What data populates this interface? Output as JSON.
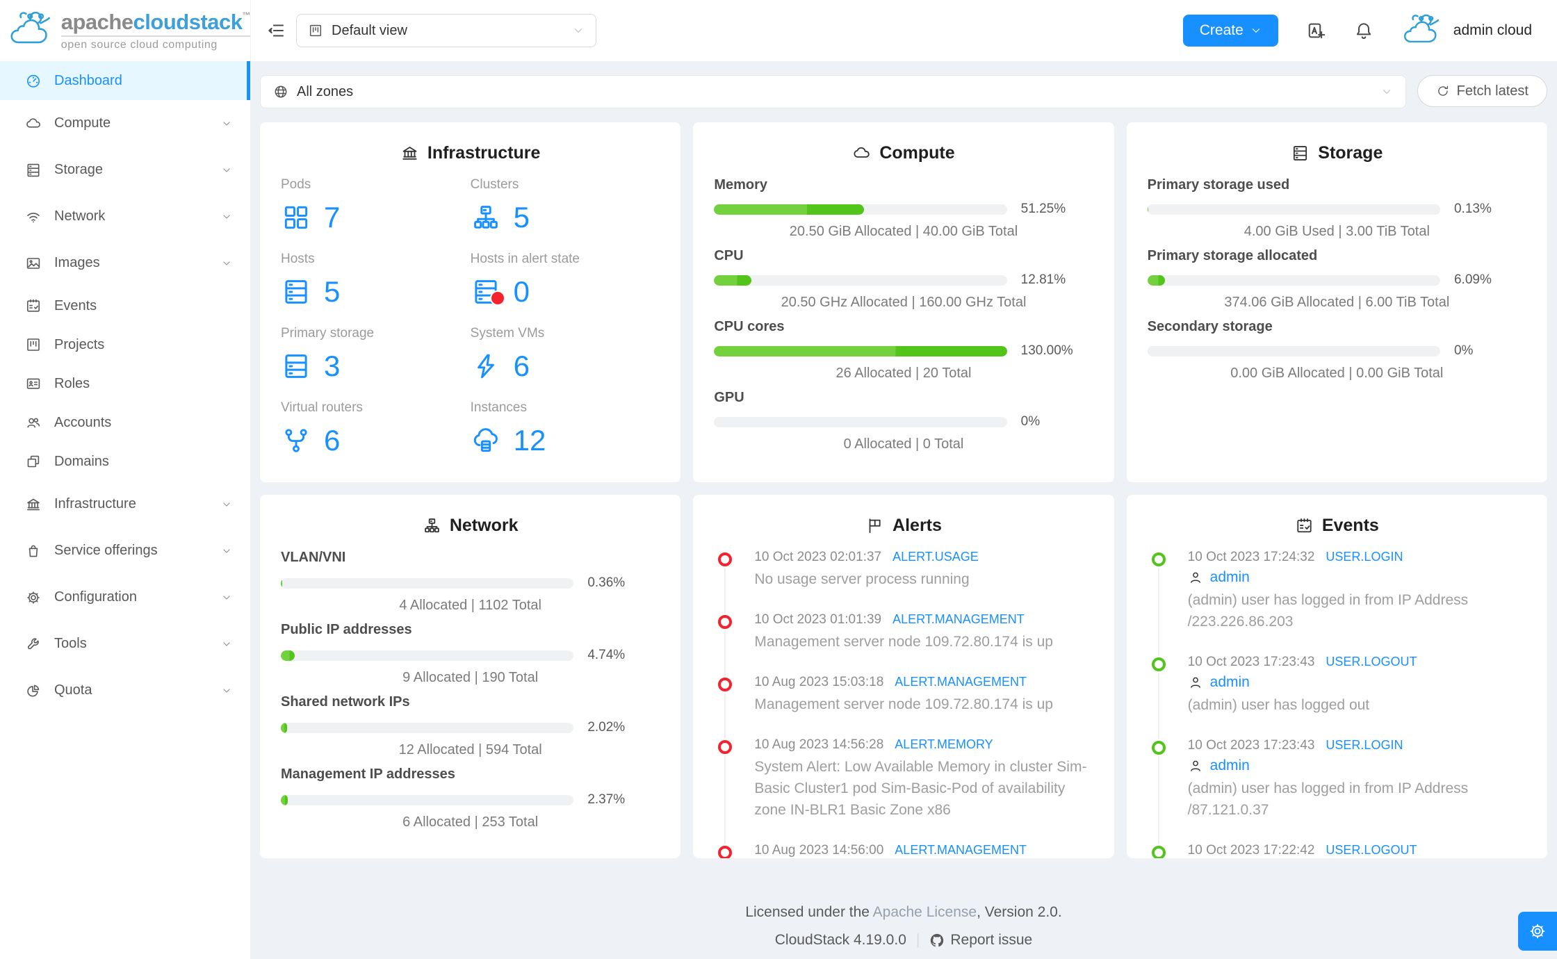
{
  "brand": {
    "title_gray": "apache",
    "title_blue": "cloudstack",
    "tm": "™",
    "subtitle": "open source cloud computing"
  },
  "header": {
    "view_select": "Default view",
    "create_label": "Create",
    "username": "admin cloud"
  },
  "zonebar": {
    "zone_select": "All zones",
    "fetch_label": "Fetch latest"
  },
  "sidebar": {
    "items": [
      {
        "label": "Dashboard"
      },
      {
        "label": "Compute"
      },
      {
        "label": "Storage"
      },
      {
        "label": "Network"
      },
      {
        "label": "Images"
      },
      {
        "label": "Events"
      },
      {
        "label": "Projects"
      },
      {
        "label": "Roles"
      },
      {
        "label": "Accounts"
      },
      {
        "label": "Domains"
      },
      {
        "label": "Infrastructure"
      },
      {
        "label": "Service offerings"
      },
      {
        "label": "Configuration"
      },
      {
        "label": "Tools"
      },
      {
        "label": "Quota"
      }
    ]
  },
  "infrastructure": {
    "title": "Infrastructure",
    "stats": [
      {
        "label": "Pods",
        "value": "7"
      },
      {
        "label": "Clusters",
        "value": "5"
      },
      {
        "label": "Hosts",
        "value": "5"
      },
      {
        "label": "Hosts in alert state",
        "value": "0"
      },
      {
        "label": "Primary storage",
        "value": "3"
      },
      {
        "label": "System VMs",
        "value": "6"
      },
      {
        "label": "Virtual routers",
        "value": "6"
      },
      {
        "label": "Instances",
        "value": "12"
      }
    ]
  },
  "compute": {
    "title": "Compute",
    "sections": [
      {
        "label": "Memory",
        "percent": "51.25%",
        "fill": 51.25,
        "info": "20.50 GiB Allocated | 40.00 GiB Total"
      },
      {
        "label": "CPU",
        "percent": "12.81%",
        "fill": 12.81,
        "info": "20.50 GHz Allocated | 160.00 GHz Total"
      },
      {
        "label": "CPU cores",
        "percent": "130.00%",
        "fill": 100,
        "info": "26 Allocated | 20 Total"
      },
      {
        "label": "GPU",
        "percent": "0%",
        "fill": 0,
        "info": "0 Allocated | 0 Total"
      }
    ]
  },
  "storage": {
    "title": "Storage",
    "sections": [
      {
        "label": "Primary storage used",
        "percent": "0.13%",
        "fill": 0.4,
        "info": "4.00 GiB Used | 3.00 TiB Total"
      },
      {
        "label": "Primary storage allocated",
        "percent": "6.09%",
        "fill": 6.09,
        "info": "374.06 GiB Allocated | 6.00 TiB Total"
      },
      {
        "label": "Secondary storage",
        "percent": "0%",
        "fill": 0,
        "info": "0.00 GiB Allocated | 0.00 GiB Total"
      }
    ]
  },
  "network": {
    "title": "Network",
    "sections": [
      {
        "label": "VLAN/VNI",
        "percent": "0.36%",
        "fill": 0.5,
        "info": "4 Allocated | 1102 Total"
      },
      {
        "label": "Public IP addresses",
        "percent": "4.74%",
        "fill": 4.74,
        "info": "9 Allocated | 190 Total"
      },
      {
        "label": "Shared network IPs",
        "percent": "2.02%",
        "fill": 2.02,
        "info": "12 Allocated | 594 Total"
      },
      {
        "label": "Management IP addresses",
        "percent": "2.37%",
        "fill": 2.37,
        "info": "6 Allocated | 253 Total"
      }
    ]
  },
  "alerts": {
    "title": "Alerts",
    "items": [
      {
        "time": "10 Oct 2023 02:01:37",
        "type": "ALERT.USAGE",
        "desc": "No usage server process running"
      },
      {
        "time": "10 Oct 2023 01:01:39",
        "type": "ALERT.MANAGEMENT",
        "desc": "Management server node 109.72.80.174 is up"
      },
      {
        "time": "10 Aug 2023 15:03:18",
        "type": "ALERT.MANAGEMENT",
        "desc": "Management server node 109.72.80.174 is up"
      },
      {
        "time": "10 Aug 2023 14:56:28",
        "type": "ALERT.MEMORY",
        "desc": "System Alert: Low Available Memory in cluster Sim-Basic Cluster1 pod Sim-Basic-Pod of availability zone IN-BLR1 Basic Zone x86"
      },
      {
        "time": "10 Aug 2023 14:56:00",
        "type": "ALERT.MANAGEMENT",
        "desc": ""
      }
    ]
  },
  "events": {
    "title": "Events",
    "items": [
      {
        "time": "10 Oct 2023 17:24:32",
        "type": "USER.LOGIN",
        "user": "admin",
        "desc": "(admin) user has logged in from IP Address /223.226.86.203"
      },
      {
        "time": "10 Oct 2023 17:23:43",
        "type": "USER.LOGOUT",
        "user": "admin",
        "desc": "(admin) user has logged out"
      },
      {
        "time": "10 Oct 2023 17:23:43",
        "type": "USER.LOGIN",
        "user": "admin",
        "desc": "(admin) user has logged in from IP Address /87.121.0.37"
      },
      {
        "time": "10 Oct 2023 17:22:42",
        "type": "USER.LOGOUT",
        "user": "",
        "desc": ""
      }
    ]
  },
  "footer": {
    "license_prefix": "Licensed under the ",
    "license_link": "Apache License",
    "license_suffix": ", Version 2.0.",
    "version": "CloudStack 4.19.0.0",
    "divider": "|",
    "report_label": "Report issue"
  },
  "colors": {
    "accent_blue": "#1890ff",
    "progress_green_dark": "#52c41a",
    "progress_green_light": "#73d13d",
    "alert_red": "#f5222d",
    "page_background": "#eef1f5"
  }
}
